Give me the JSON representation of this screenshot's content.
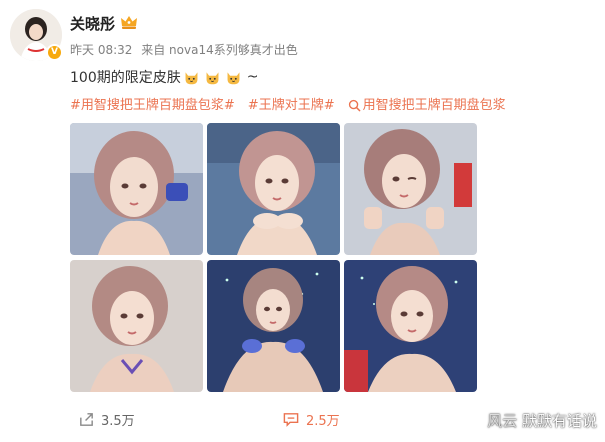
{
  "post": {
    "username": "关晓彤",
    "meta": {
      "date": "昨天 08:32",
      "source": "来自 nova14系列够真才出色"
    },
    "text": "100期的限定皮肤",
    "text_tail": "~",
    "emoji_icon": "cat-face-icon",
    "hashtags": [
      "#用智搜把王牌百期盘包浆#",
      "#王牌对王牌#",
      "用智搜把王牌百期盘包浆"
    ]
  },
  "actions": {
    "repost_count": "3.5万",
    "comment_count": "2.5万"
  },
  "watermark": {
    "prefix": "风云",
    "text": "默默有话说"
  },
  "colors": {
    "hashtag": "#eb7350",
    "meta": "#808080",
    "badge": "#f7a90d"
  },
  "icons": [
    "crown-icon",
    "verified-badge-icon",
    "search-icon",
    "repost-icon",
    "comment-icon"
  ]
}
